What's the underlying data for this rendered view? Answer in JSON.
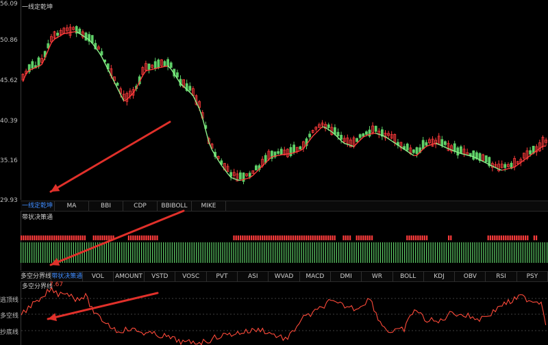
{
  "main_panel": {
    "title": "一线定乾坤",
    "y_labels": [
      "56.09",
      "50.86",
      "45.62",
      "40.39",
      "35.16",
      "29.93"
    ]
  },
  "indicator_tabs_1": [
    "一线定乾坤",
    "MA",
    "BBI",
    "CDP",
    "BBIBOLL",
    "MIKE"
  ],
  "band_panel": {
    "title": "带状决策通"
  },
  "indicator_tabs_2": [
    "多空分界线",
    "带状决策通",
    "VOL",
    "AMOUNT",
    "VSTD",
    "VOSC",
    "PVT",
    "ASI",
    "WVAD",
    "MACD",
    "DMI",
    "WR",
    "BOLL",
    "KDJ",
    "OBV",
    "RSI",
    "PSY"
  ],
  "line_panel": {
    "title": "多空分界线",
    "value": "7.67",
    "y_labels": [
      "逃顶线",
      "多空线",
      "抄底线"
    ]
  },
  "colors": {
    "up": "#ff3b3b",
    "down": "#5fd068",
    "accent": "#3f8cff",
    "arrow": "#e0302a",
    "line": "#ff4a3a"
  }
}
